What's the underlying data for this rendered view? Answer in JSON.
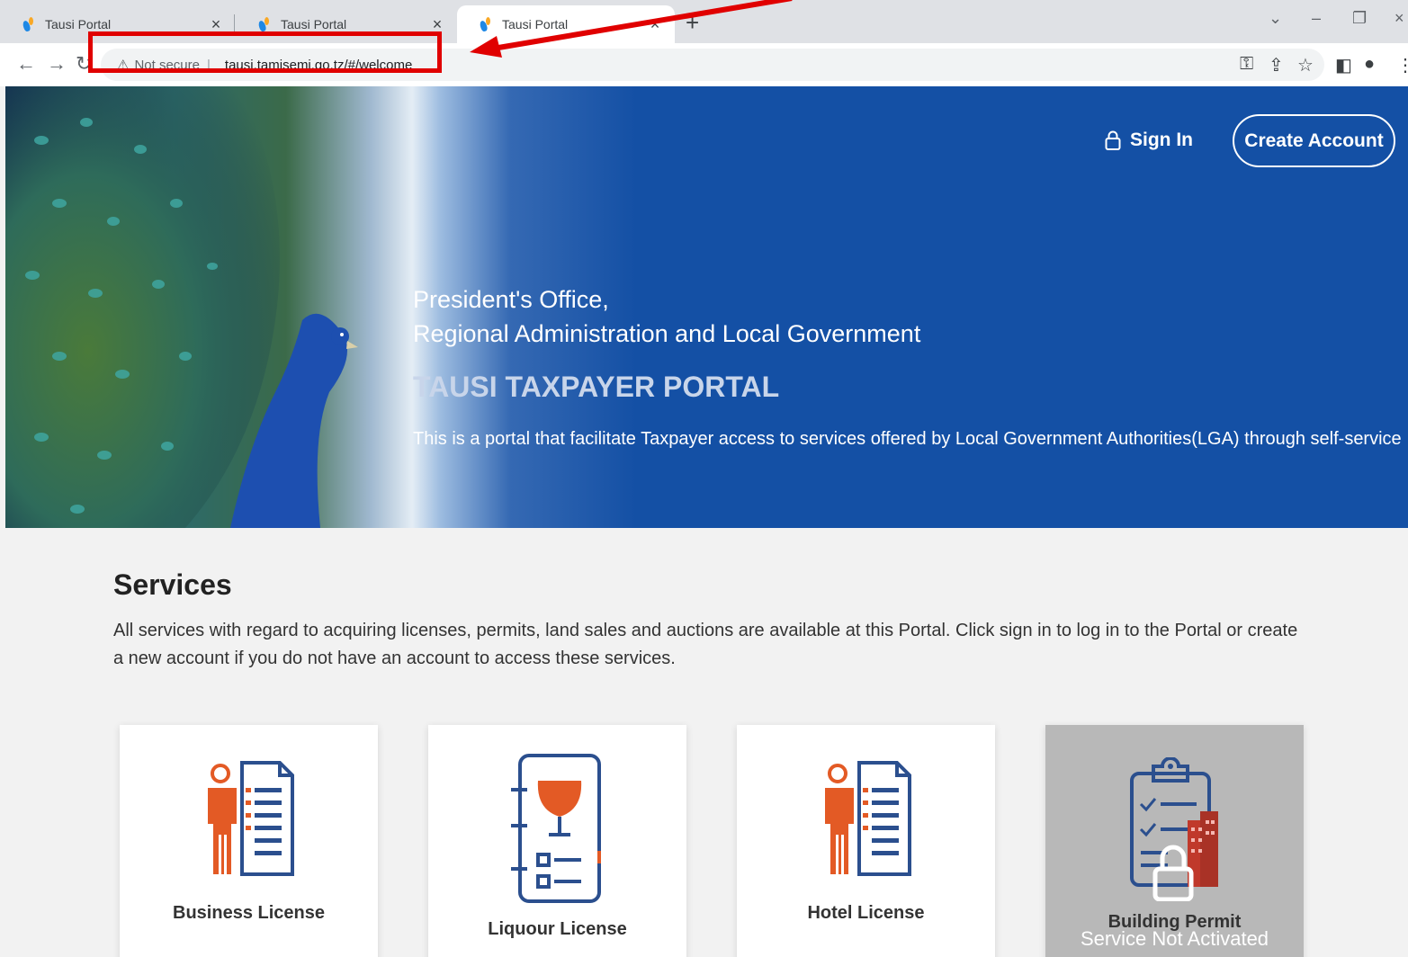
{
  "browser": {
    "tabs": [
      {
        "title": "Tausi Portal"
      },
      {
        "title": "Tausi Portal"
      },
      {
        "title": "Tausi Portal"
      }
    ],
    "omnibox": {
      "security_label": "Not secure",
      "url": "tausi.tamisemi.go.tz/#/welcome"
    }
  },
  "header": {
    "sign_in_label": "Sign In",
    "create_account_label": "Create Account"
  },
  "hero": {
    "org_line1": "President's Office,",
    "org_line2": "Regional Administration and Local Government",
    "title": "TAUSI TAXPAYER PORTAL",
    "description": "This is a portal that facilitate Taxpayer access to services offered by Local Government Authorities(LGA) through self-service"
  },
  "services": {
    "title": "Services",
    "description": "All services with regard to acquiring licenses, permits, land sales and auctions are available at this Portal. Click sign in to log in to the Portal or create a new account if you do not have an account to access these services.",
    "cards": [
      {
        "label": "Business License"
      },
      {
        "label": "Liquour License"
      },
      {
        "label": "Hotel License"
      },
      {
        "label": "Building Permit",
        "status": "Service Not Activated"
      }
    ]
  },
  "colors": {
    "hero_blue": "#1450a5",
    "accent_orange": "#e35a25",
    "icon_blue": "#2b4f8e",
    "annotation_red": "#e00000"
  }
}
